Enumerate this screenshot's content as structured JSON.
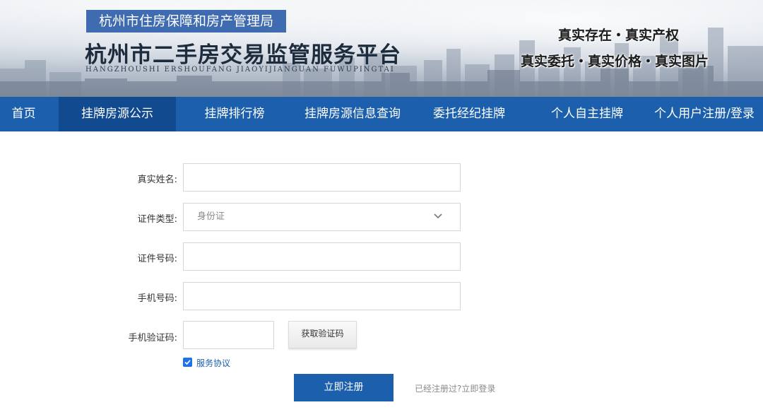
{
  "header": {
    "bureau": "杭州市住房保障和房产管理局",
    "title": "杭州市二手房交易监管服务平台",
    "pinyin": "HANGZHOUSHI   ERSHOUFANG   JIAOYIJIANGUAN   FUWUPINGTAI",
    "slogan_line1": "真实存在・真实产权",
    "slogan_line2": "真实委托・真实价格・真实图片"
  },
  "nav": {
    "items": [
      {
        "label": "首页"
      },
      {
        "label": "挂牌房源公示"
      },
      {
        "label": "挂牌排行榜"
      },
      {
        "label": "挂牌房源信息查询"
      },
      {
        "label": "委托经纪挂牌"
      },
      {
        "label": "个人自主挂牌"
      },
      {
        "label": "个人用户注册/登录"
      }
    ],
    "active_index": 1
  },
  "form": {
    "name_label": "真实姓名:",
    "name_value": "",
    "id_type_label": "证件类型:",
    "id_type_value": "身份证",
    "id_number_label": "证件号码:",
    "id_number_value": "",
    "phone_label": "手机号码:",
    "phone_value": "",
    "code_label": "手机验证码:",
    "code_value": "",
    "get_code_button": "获取验证码",
    "agreement_checked": true,
    "agreement_link": "服务协议",
    "submit_button": "立即注册",
    "registered_hint": "已经注册过?",
    "login_link": "立即登录"
  },
  "colors": {
    "nav_bg": "#1c60ad",
    "nav_active_bg": "#114a8f",
    "bureau_box_bg": "#3f6bb0",
    "checkbox": "#1a73e8"
  }
}
